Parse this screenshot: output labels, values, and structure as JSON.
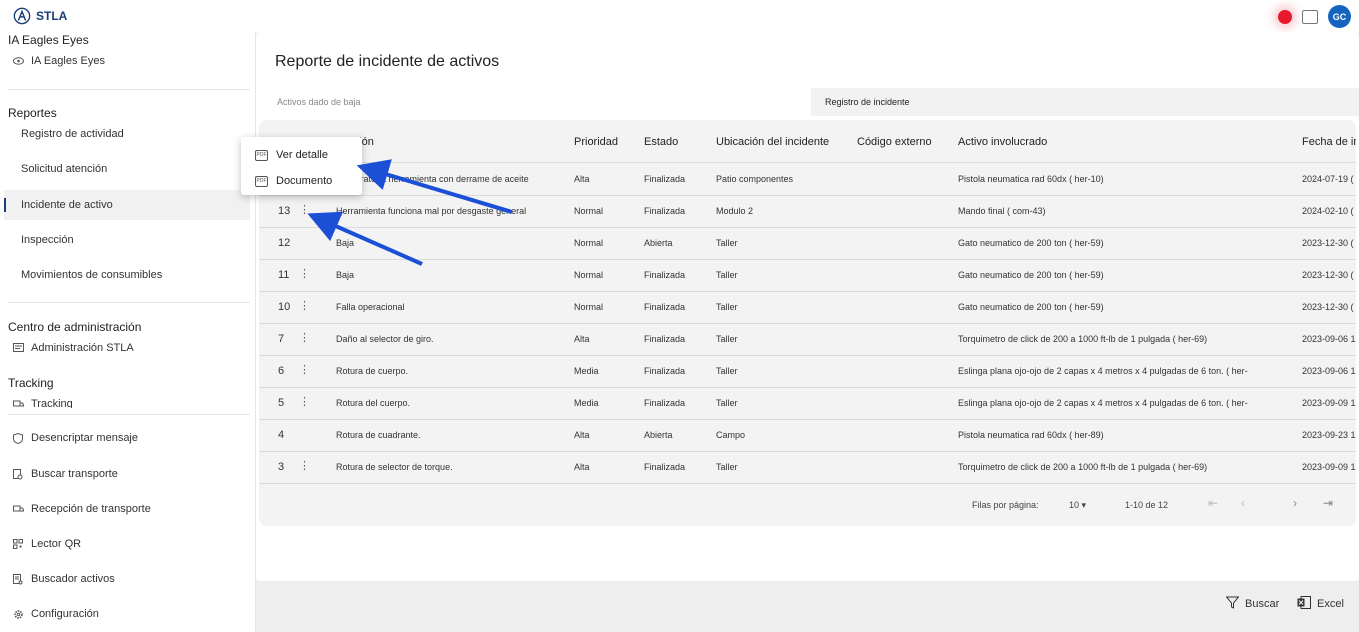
{
  "header": {
    "app_name": "STLA",
    "avatar_initials": "GC",
    "record_color": "#e8192c",
    "accent": "#1565c0"
  },
  "sidebar": {
    "sections": [
      {
        "title": "IA Eagles Eyes"
      },
      {
        "title": "Reportes"
      },
      {
        "title": "Centro de administración"
      },
      {
        "title": "Tracking"
      }
    ],
    "ia_items": [
      {
        "label": "IA Eagles Eyes",
        "icon": "eye-icon"
      }
    ],
    "report_items": [
      {
        "label": "Registro de actividad"
      },
      {
        "label": "Solicitud atención"
      },
      {
        "label": "Incidente de activo"
      },
      {
        "label": "Inspección"
      },
      {
        "label": "Movimientos de consumibles"
      }
    ],
    "admin_items": [
      {
        "label": "Administración STLA",
        "icon": "admin-icon"
      }
    ],
    "tracking_items": [
      {
        "label": "Tracking",
        "icon": "truck-icon"
      }
    ],
    "bottom_items": [
      {
        "label": "Desencriptar mensaje",
        "icon": "shield-icon"
      },
      {
        "label": "Buscar transporte",
        "icon": "document-search-icon"
      },
      {
        "label": "Recepción de transporte",
        "icon": "truck-icon"
      },
      {
        "label": "Lector QR",
        "icon": "qr-icon"
      },
      {
        "label": "Buscador activos",
        "icon": "list-search-icon"
      },
      {
        "label": "Configuración",
        "icon": "gear-icon"
      }
    ]
  },
  "page": {
    "title": "Reporte de incidente de activos",
    "tabs": [
      {
        "label": "Activos dado de baja"
      },
      {
        "label": "Registro de incidente"
      }
    ]
  },
  "table": {
    "columns": [
      "Descripción",
      "Prioridad",
      "Estado",
      "Ubicación del incidente",
      "Código externo",
      "Activo involucrado",
      "Fecha de in"
    ],
    "column_visible_fragment": "cripción",
    "rows": [
      {
        "id": "",
        "desc": "Brazo giratorio herramienta con derrame de aceite",
        "desc_visible": "a giratoria herramienta con derrame de aceite",
        "prio": "Alta",
        "estado": "Finalizada",
        "ubic": "Patio componentes",
        "cod": "",
        "activo": "Pistola neumatica rad 60dx ( her-10)",
        "fecha": "2024-07-19 ("
      },
      {
        "id": "13",
        "desc": "Herramienta funciona mal por desgaste general",
        "prio": "Normal",
        "estado": "Finalizada",
        "ubic": "Modulo 2",
        "cod": "",
        "activo": "Mando final ( com-43)",
        "fecha": "2024-02-10 ("
      },
      {
        "id": "12",
        "desc": "Baja",
        "prio": "Normal",
        "estado": "Abierta",
        "ubic": "Taller",
        "cod": "",
        "activo": "Gato neumatico de 200 ton ( her-59)",
        "fecha": "2023-12-30 ("
      },
      {
        "id": "11",
        "desc": "Baja",
        "prio": "Normal",
        "estado": "Finalizada",
        "ubic": "Taller",
        "cod": "",
        "activo": "Gato neumatico de 200 ton ( her-59)",
        "fecha": "2023-12-30 ("
      },
      {
        "id": "10",
        "desc": "Falla operacional",
        "prio": "Normal",
        "estado": "Finalizada",
        "ubic": "Taller",
        "cod": "",
        "activo": "Gato neumatico de 200 ton ( her-59)",
        "fecha": "2023-12-30 ("
      },
      {
        "id": "7",
        "desc": "Daño al selector de giro.",
        "prio": "Alta",
        "estado": "Finalizada",
        "ubic": "Taller",
        "cod": "",
        "activo": "Torquimetro de click de 200 a 1000 ft-lb de 1 pulgada ( her-69)",
        "fecha": "2023-09-06 1"
      },
      {
        "id": "6",
        "desc": "Rotura de cuerpo.",
        "prio": "Media",
        "estado": "Finalizada",
        "ubic": "Taller",
        "cod": "",
        "activo": "Eslinga plana ojo-ojo de 2 capas x 4 metros x 4 pulgadas de 6 ton. ( her-",
        "fecha": "2023-09-06 1"
      },
      {
        "id": "5",
        "desc": "Rotura del cuerpo.",
        "prio": "Media",
        "estado": "Finalizada",
        "ubic": "Taller",
        "cod": "",
        "activo": "Eslinga plana ojo-ojo de 2 capas x 4 metros x 4 pulgadas de 6 ton. ( her-",
        "fecha": "2023-09-09 1"
      },
      {
        "id": "4",
        "desc": "Rotura de cuadrante.",
        "prio": "Alta",
        "estado": "Abierta",
        "ubic": "Campo",
        "cod": "",
        "activo": "Pistola neumatica rad 60dx ( her-89)",
        "fecha": "2023-09-23 1"
      },
      {
        "id": "3",
        "desc": "Rotura de selector de torque.",
        "prio": "Alta",
        "estado": "Finalizada",
        "ubic": "Taller",
        "cod": "",
        "activo": "Torquimetro de click de 200 a 1000 ft-lb de 1 pulgada ( her-69)",
        "fecha": "2023-09-09 1"
      }
    ],
    "rows_visible_desc": [
      "a giratoria herramienta con derrame de aceite"
    ]
  },
  "pagination": {
    "rows_label": "Filas por página:",
    "rows_value": "10",
    "range": "1-10 de 12"
  },
  "actions": {
    "search_label": "Buscar",
    "excel_label": "Excel"
  },
  "context_menu": {
    "items": [
      {
        "label": "Ver detalle",
        "icon": "document-icon"
      },
      {
        "label": "Documento",
        "icon": "document-icon"
      }
    ]
  },
  "annotation_color": "#1a4fd6"
}
